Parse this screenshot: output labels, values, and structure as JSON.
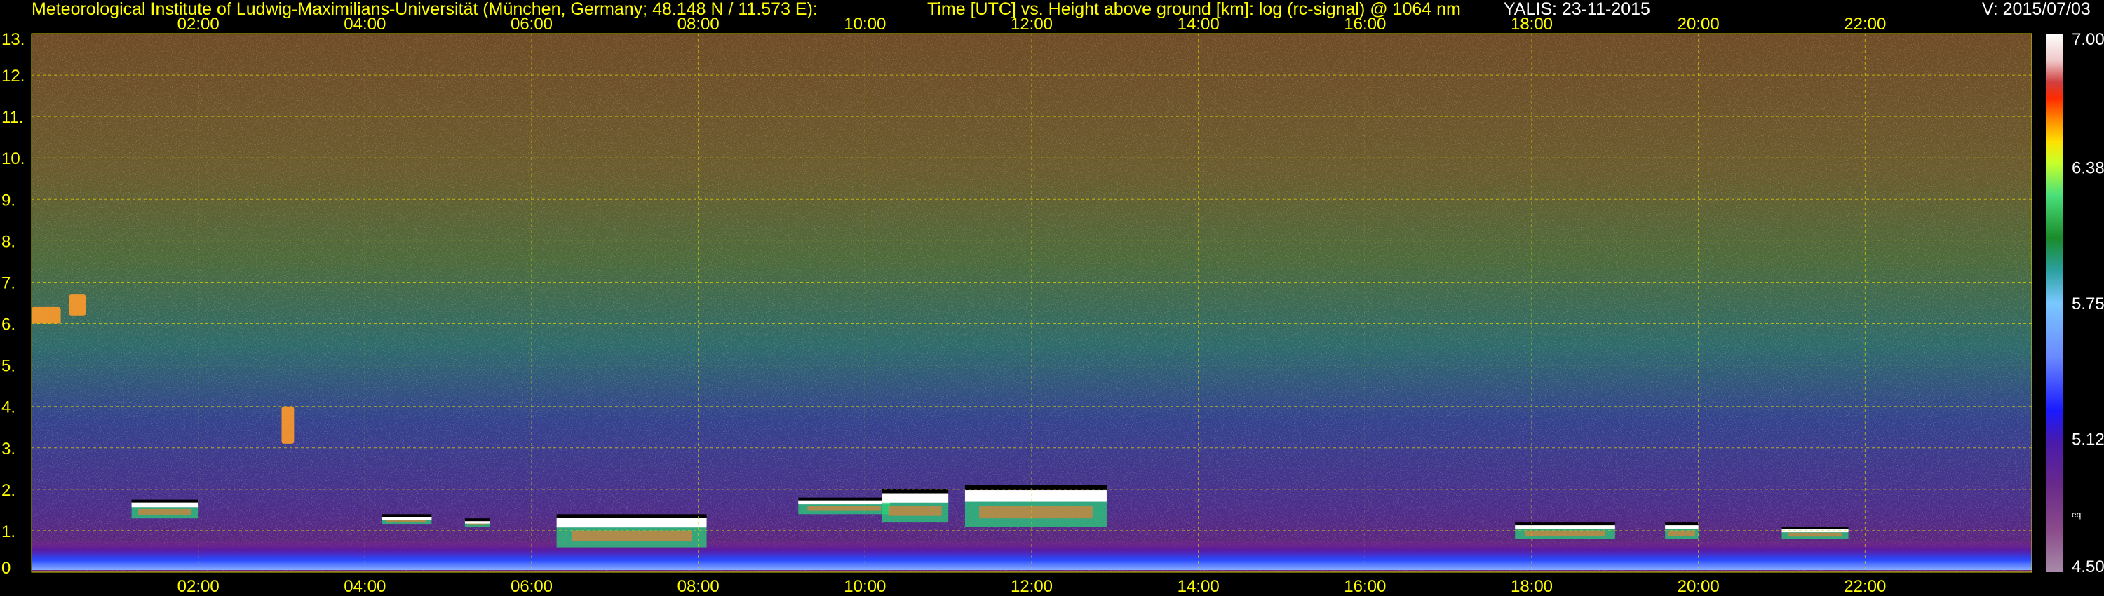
{
  "header": {
    "institute": "Meteorological Institute of Ludwig-Maximilians-Universität (München, Germany; 48.148 N / 11.573 E):",
    "axes_desc": "Time [UTC] vs. Height above ground [km]: log (rc-signal) @ 1064 nm",
    "station": "YALIS: 23-11-2015",
    "version": "V: 2015/07/03"
  },
  "chart_data": {
    "type": "heatmap",
    "title": "Time [UTC] vs. Height above ground [km]: log (rc-signal) @ 1064 nm",
    "x_tick_labels": [
      "02:00",
      "04:00",
      "06:00",
      "08:00",
      "10:00",
      "12:00",
      "14:00",
      "16:00",
      "18:00",
      "20:00",
      "22:00"
    ],
    "x_range_hours": [
      0,
      24
    ],
    "y_tick_labels": [
      "0",
      "1.",
      "2.",
      "3.",
      "4.",
      "5.",
      "6.",
      "7.",
      "8.",
      "9.",
      "10.",
      "11.",
      "12.",
      "13."
    ],
    "y_range_km": [
      0,
      13
    ],
    "grid": true,
    "colorbar": {
      "labels": [
        "7.00",
        "6.38",
        "5.75",
        "5.12",
        "4.50"
      ],
      "range": [
        4.5,
        7.0
      ],
      "small_label": "eq"
    },
    "features": [
      {
        "name": "boundary-layer",
        "t_start": 0.0,
        "t_end": 24.0,
        "h_low": 0.05,
        "h_high": 0.75
      },
      {
        "name": "cloud",
        "t_start": 1.2,
        "t_end": 2.0,
        "h_low": 1.3,
        "h_high": 1.75
      },
      {
        "name": "cloud",
        "t_start": 4.2,
        "t_end": 4.8,
        "h_low": 1.15,
        "h_high": 1.4
      },
      {
        "name": "cloud",
        "t_start": 5.2,
        "t_end": 5.5,
        "h_low": 1.1,
        "h_high": 1.3
      },
      {
        "name": "cloud",
        "t_start": 6.3,
        "t_end": 8.1,
        "h_low": 0.6,
        "h_high": 1.4
      },
      {
        "name": "cloud",
        "t_start": 9.2,
        "t_end": 10.3,
        "h_low": 1.4,
        "h_high": 1.8
      },
      {
        "name": "cloud",
        "t_start": 10.2,
        "t_end": 11.0,
        "h_low": 1.2,
        "h_high": 2.0
      },
      {
        "name": "cloud",
        "t_start": 11.2,
        "t_end": 12.9,
        "h_low": 1.1,
        "h_high": 2.1
      },
      {
        "name": "cloud",
        "t_start": 17.8,
        "t_end": 19.0,
        "h_low": 0.8,
        "h_high": 1.2
      },
      {
        "name": "cloud",
        "t_start": 19.6,
        "t_end": 20.0,
        "h_low": 0.8,
        "h_high": 1.2
      },
      {
        "name": "cloud",
        "t_start": 21.0,
        "t_end": 21.8,
        "h_low": 0.8,
        "h_high": 1.1
      },
      {
        "name": "aerosol-layer",
        "t_start": 0.0,
        "t_end": 0.35,
        "h_low": 6.0,
        "h_high": 6.4
      },
      {
        "name": "aerosol-layer",
        "t_start": 0.45,
        "t_end": 0.65,
        "h_low": 6.2,
        "h_high": 6.7
      },
      {
        "name": "aerosol-layer",
        "t_start": 3.0,
        "t_end": 3.15,
        "h_low": 3.1,
        "h_high": 4.0
      }
    ]
  }
}
